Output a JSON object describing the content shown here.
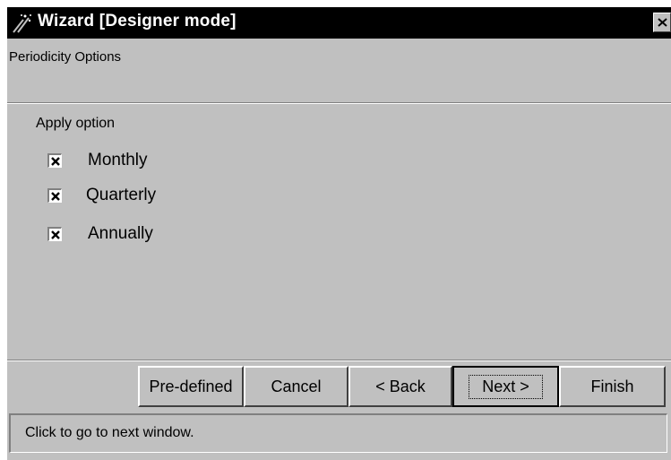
{
  "window": {
    "title": "Wizard  [Designer mode]",
    "icon": "wizard-wand-icon",
    "close_icon": "close-icon"
  },
  "header": {
    "text": "Periodicity Options"
  },
  "group": {
    "label": "Apply option",
    "options": [
      {
        "label": "Monthly",
        "checked": true
      },
      {
        "label": "Quarterly",
        "checked": true
      },
      {
        "label": "Annually",
        "checked": true
      }
    ]
  },
  "buttons": {
    "predefined": "Pre-defined",
    "cancel": "Cancel",
    "back": "< Back",
    "next": "Next >",
    "finish": "Finish"
  },
  "status": {
    "text": "Click to go to next window."
  }
}
